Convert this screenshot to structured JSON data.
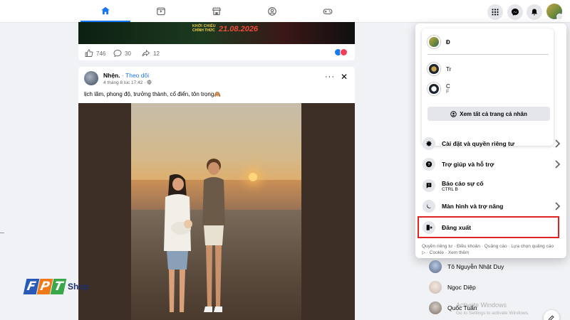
{
  "nav": {
    "tabs": [
      "home-icon",
      "watch-icon",
      "marketplace-icon",
      "groups-icon",
      "gaming-icon"
    ],
    "active_tab": "home-icon",
    "right_buttons": [
      "menu-grid-icon",
      "messenger-icon",
      "notifications-icon",
      "account-avatar"
    ]
  },
  "feed": {
    "post1": {
      "banner_line1": "KHỞI CHIẾU",
      "banner_line2": "CHÍNH THỨC",
      "banner_date": "21.08.2026",
      "like_count": "746",
      "comment_count": "30",
      "share_count": "12"
    },
    "post2": {
      "author": "Nhện.",
      "follow_label": "· Theo dõi",
      "timestamp": "4 tháng 8 lúc 17:42 · ",
      "caption": "lịch lãm, phong độ, trưởng thành, cổ điển, tôn trọng🙈",
      "more_label": "···",
      "close_label": "✕"
    }
  },
  "account_menu": {
    "profiles": [
      {
        "name": "Đ",
        "sub": ""
      },
      {
        "name": "Tr",
        "sub": ""
      },
      {
        "name": "C",
        "sub": "F"
      }
    ],
    "see_all_label": "Xem tất cả trang cá nhân",
    "items": [
      {
        "label": "Cài đặt và quyền riêng tư",
        "icon": "gear-icon",
        "has_chevron": true
      },
      {
        "label": "Trợ giúp và hỗ trợ",
        "icon": "help-icon",
        "has_chevron": true
      },
      {
        "label": "Báo cáo sự cố",
        "sub": "CTRL B",
        "icon": "report-icon",
        "has_chevron": false
      },
      {
        "label": "Màn hình và trợ năng",
        "icon": "moon-icon",
        "has_chevron": true
      },
      {
        "label": "Đăng xuất",
        "icon": "logout-icon",
        "has_chevron": false,
        "highlighted": true
      }
    ],
    "footer": "Quyền riêng tư · Điều khoản · Quảng cáo · Lựa chọn quảng cáo ▷ · Cookie · Xem thêm"
  },
  "contacts": [
    {
      "name": "Tô Nguyễn Nhật Duy"
    },
    {
      "name": "Ngọc Diệp"
    },
    {
      "name": "Quốc Tuấn"
    }
  ],
  "watermark": {
    "title": "Activate Windows",
    "subtitle": "Go to Settings to activate Windows."
  },
  "brand": {
    "logo_letters": [
      "F",
      "P",
      "T"
    ],
    "logo_text": "Shop",
    "colors": {
      "f": "#2a5ab8",
      "p": "#f07a1a",
      "t": "#3aa84a"
    }
  },
  "colors": {
    "accent": "#1877f2",
    "logout_highlight": "#e02424"
  }
}
